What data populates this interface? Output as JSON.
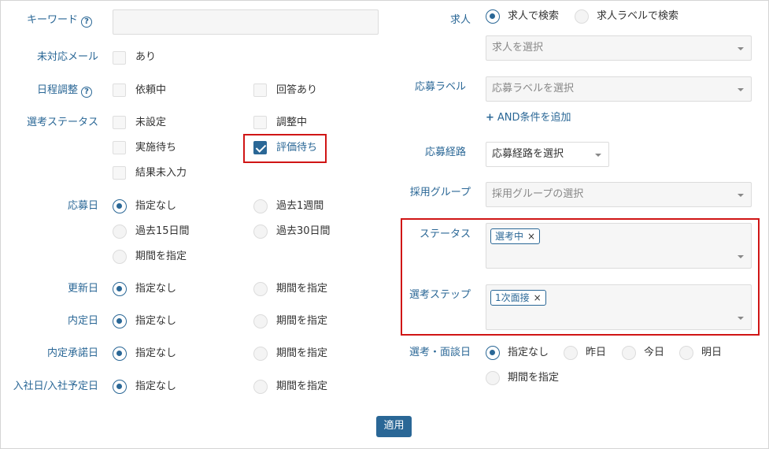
{
  "colors": {
    "accent": "#2a6796",
    "highlight": "#d01515"
  },
  "left": {
    "keyword_label": "キーワード",
    "unhandled_mail_label": "未対応メール",
    "unhandled_mail_option": "あり",
    "schedule_label": "日程調整",
    "schedule_opt1": "依頼中",
    "schedule_opt2": "回答あり",
    "selection_status_label": "選考ステータス",
    "status_opt1": "未設定",
    "status_opt2": "調整中",
    "status_opt3": "実施待ち",
    "status_opt4": "評価待ち",
    "status_opt5": "結果未入力",
    "apply_date_label": "応募日",
    "apply_opt1": "指定なし",
    "apply_opt2": "過去1週間",
    "apply_opt3": "過去15日間",
    "apply_opt4": "過去30日間",
    "apply_opt5": "期間を指定",
    "updated_label": "更新日",
    "offer_label": "内定日",
    "offer_accept_label": "内定承諾日",
    "join_label": "入社日/入社予定日",
    "opt_none": "指定なし",
    "opt_range": "期間を指定"
  },
  "right": {
    "job_label": "求人",
    "job_radio1": "求人で検索",
    "job_radio2": "求人ラベルで検索",
    "job_select_placeholder": "求人を選択",
    "apply_label_label": "応募ラベル",
    "apply_label_placeholder": "応募ラベルを選択",
    "add_and_condition": "AND条件を追加",
    "route_label": "応募経路",
    "route_placeholder": "応募経路を選択",
    "group_label": "採用グループ",
    "group_placeholder": "採用グループの選択",
    "status_label": "ステータス",
    "status_tag": "選考中",
    "step_label": "選考ステップ",
    "step_tag": "1次面接",
    "interview_date_label": "選考・面談日",
    "interview_opt1": "指定なし",
    "interview_opt2": "昨日",
    "interview_opt3": "今日",
    "interview_opt4": "明日",
    "interview_opt5": "期間を指定"
  },
  "apply_button": "適用"
}
